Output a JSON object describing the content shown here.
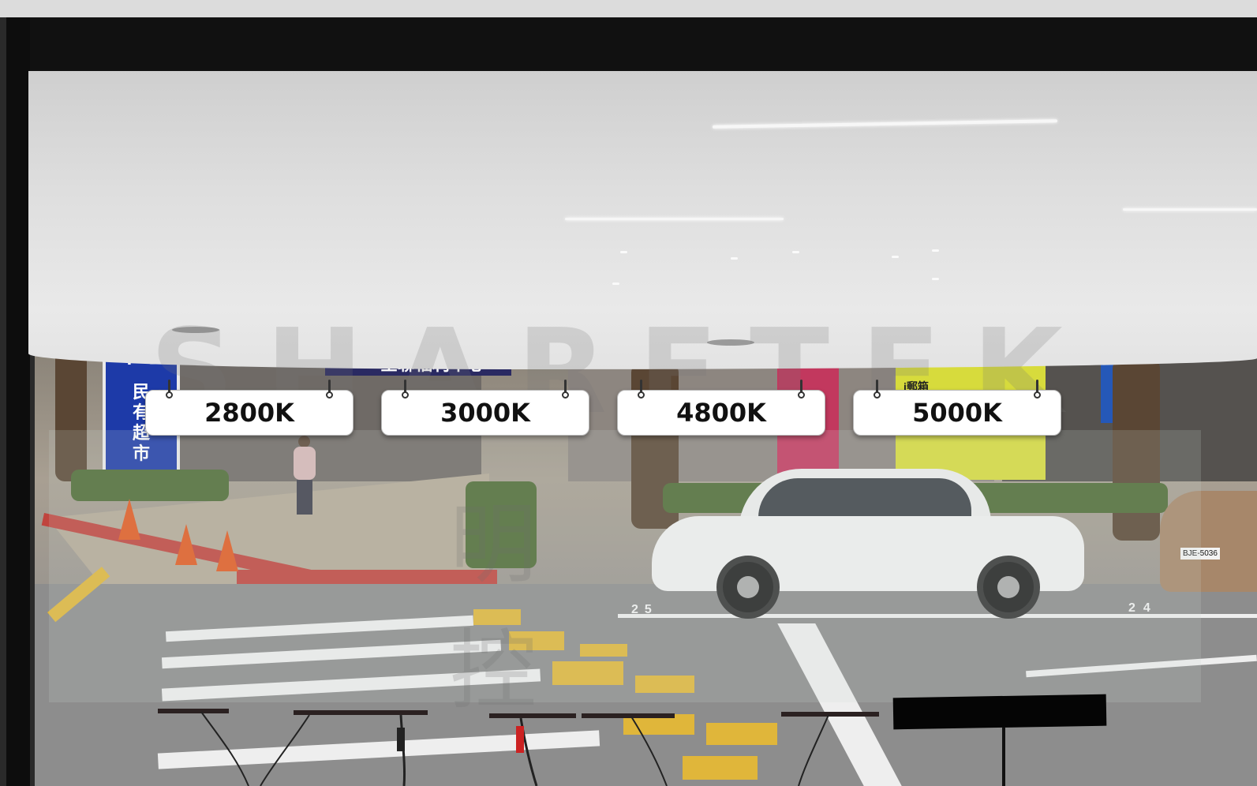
{
  "scene": {
    "description_labels": [
      "2800K",
      "3000K",
      "4800K",
      "5000K"
    ]
  },
  "labels": [
    {
      "text": "2800K"
    },
    {
      "text": "3000K"
    },
    {
      "text": "4800K"
    },
    {
      "text": "5000K"
    }
  ],
  "signs": {
    "pillar_sign_top": "中心",
    "pillar_sign_vertical": [
      "民",
      "有",
      "超",
      "市"
    ],
    "store_sign": "全聯福利中心",
    "locker_sign": "i郵箱"
  },
  "watermark": {
    "text": "SHARETEK",
    "sub_text": "明 控"
  },
  "road_markings": {
    "space_left": "25",
    "space_right": "24"
  },
  "car": {
    "plate": "BJE-5036"
  }
}
